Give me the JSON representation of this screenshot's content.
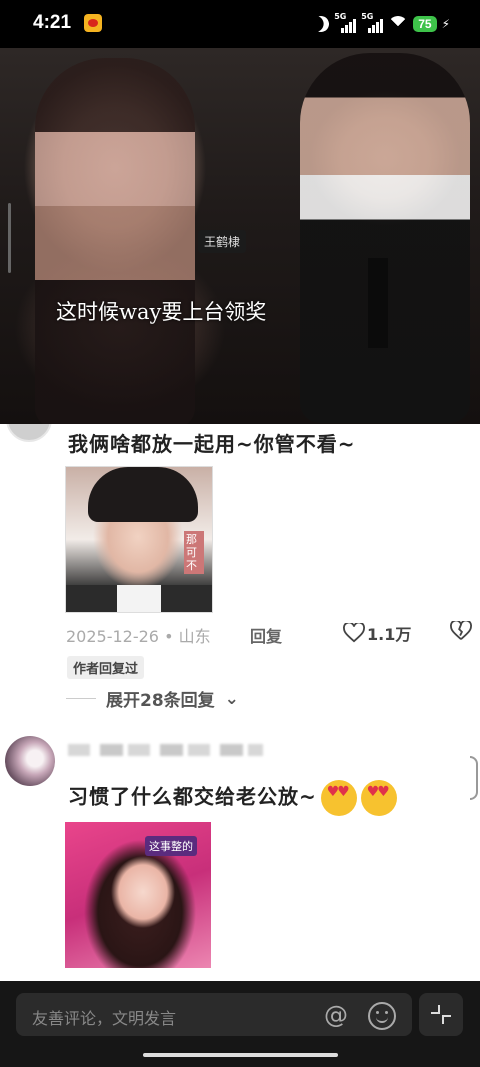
{
  "status_bar": {
    "time": "4:21",
    "net1": "5G",
    "net2": "5G",
    "battery": "75"
  },
  "video": {
    "caption": "这时候way要上台领奖",
    "seat_label": "王鹤棣"
  },
  "comment1": {
    "text": "我俩啥都放一起用~你管不看~",
    "image_tag": "那可不",
    "date": "2025-12-26",
    "location": "山东",
    "reply_label": "回复",
    "likes": "1.1万",
    "author_badge": "作者回复过",
    "expand_label": "展开28条回复"
  },
  "comment2": {
    "text": "习惯了什么都交给老公放~",
    "image_stamp": "这事整的"
  },
  "bottom_bar": {
    "placeholder": "友善评论，文明发言"
  }
}
